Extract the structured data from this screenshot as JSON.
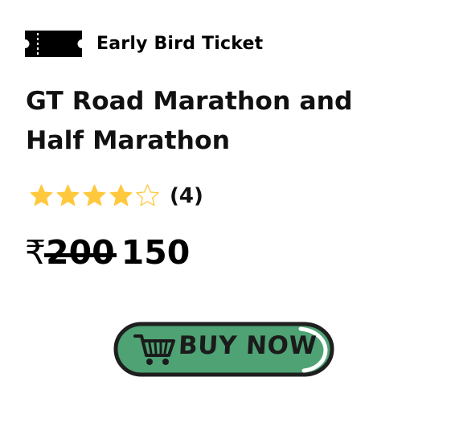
{
  "badge": {
    "icon": "ticket-icon",
    "label": "Early Bird Ticket"
  },
  "event": {
    "title": "GT Road Marathon and Half Marathon"
  },
  "rating": {
    "value": 4,
    "max": 5,
    "count_label": "(4)",
    "star_color": "#FFC83D"
  },
  "price": {
    "currency": "₹",
    "original": "200",
    "current": "150"
  },
  "cta": {
    "label": "BUY NOW",
    "icon": "shopping-cart-icon",
    "color": "#4EA274"
  }
}
